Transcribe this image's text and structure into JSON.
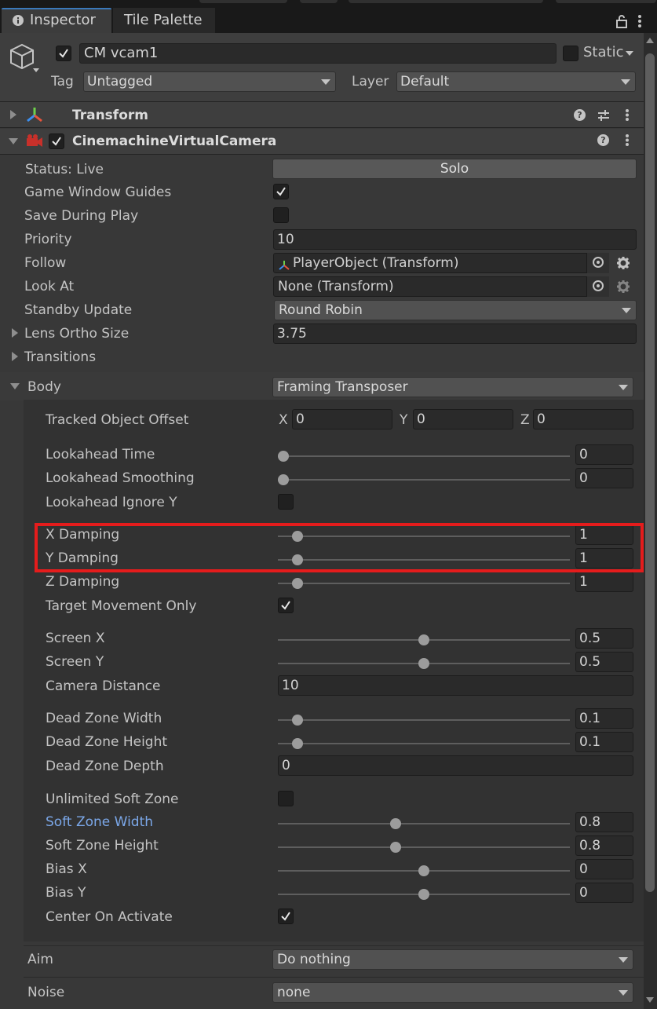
{
  "tabs": {
    "inspector": "Inspector",
    "tile_palette": "Tile Palette"
  },
  "header": {
    "object_name": "CM vcam1",
    "static_label": "Static",
    "tag_label": "Tag",
    "tag_value": "Untagged",
    "layer_label": "Layer",
    "layer_value": "Default"
  },
  "transform": {
    "title": "Transform"
  },
  "vcam": {
    "title": "CinemachineVirtualCamera",
    "status_label": "Status: Live",
    "solo_label": "Solo",
    "game_window_guides_label": "Game Window Guides",
    "game_window_guides_checked": true,
    "save_during_play_label": "Save During Play",
    "save_during_play_checked": false,
    "priority_label": "Priority",
    "priority_value": "10",
    "follow_label": "Follow",
    "follow_value": "PlayerObject (Transform)",
    "look_at_label": "Look At",
    "look_at_value": "None (Transform)",
    "standby_label": "Standby Update",
    "standby_value": "Round Robin",
    "lens_label": "Lens Ortho Size",
    "lens_value": "3.75",
    "transitions_label": "Transitions",
    "body_label": "Body",
    "body_value": "Framing Transposer",
    "aim_label": "Aim",
    "aim_value": "Do nothing",
    "noise_label": "Noise",
    "noise_value": "none"
  },
  "body": {
    "tracked_offset_label": "Tracked Object Offset",
    "offset": {
      "x_label": "X",
      "x": "0",
      "y_label": "Y",
      "y": "0",
      "z_label": "Z",
      "z": "0"
    },
    "lookahead_time": {
      "label": "Lookahead Time",
      "value": "0",
      "slider": 0.0
    },
    "lookahead_smoothing": {
      "label": "Lookahead Smoothing",
      "value": "0",
      "slider": 0.0
    },
    "lookahead_ignore_y": {
      "label": "Lookahead Ignore Y",
      "checked": false
    },
    "x_damping": {
      "label": "X Damping",
      "value": "1",
      "slider": 0.05
    },
    "y_damping": {
      "label": "Y Damping",
      "value": "1",
      "slider": 0.05
    },
    "z_damping": {
      "label": "Z Damping",
      "value": "1",
      "slider": 0.05
    },
    "target_movement_only": {
      "label": "Target Movement Only",
      "checked": true
    },
    "screen_x": {
      "label": "Screen X",
      "value": "0.5",
      "slider": 0.5
    },
    "screen_y": {
      "label": "Screen Y",
      "value": "0.5",
      "slider": 0.5
    },
    "camera_distance": {
      "label": "Camera Distance",
      "value": "10"
    },
    "dead_zone_width": {
      "label": "Dead Zone Width",
      "value": "0.1",
      "slider": 0.05
    },
    "dead_zone_height": {
      "label": "Dead Zone Height",
      "value": "0.1",
      "slider": 0.05
    },
    "dead_zone_depth": {
      "label": "Dead Zone Depth",
      "value": "0"
    },
    "unlimited_soft_zone": {
      "label": "Unlimited Soft Zone",
      "checked": false
    },
    "soft_zone_width": {
      "label": "Soft Zone Width",
      "value": "0.8",
      "slider": 0.4
    },
    "soft_zone_height": {
      "label": "Soft Zone Height",
      "value": "0.8",
      "slider": 0.4
    },
    "bias_x": {
      "label": "Bias X",
      "value": "0",
      "slider": 0.5
    },
    "bias_y": {
      "label": "Bias Y",
      "value": "0",
      "slider": 0.5
    },
    "center_on_activate": {
      "label": "Center On Activate",
      "checked": true
    }
  },
  "colors": {
    "accent": "#3a79bb",
    "highlight": "#e51c1c",
    "label_blue": "#7ba7e8"
  }
}
